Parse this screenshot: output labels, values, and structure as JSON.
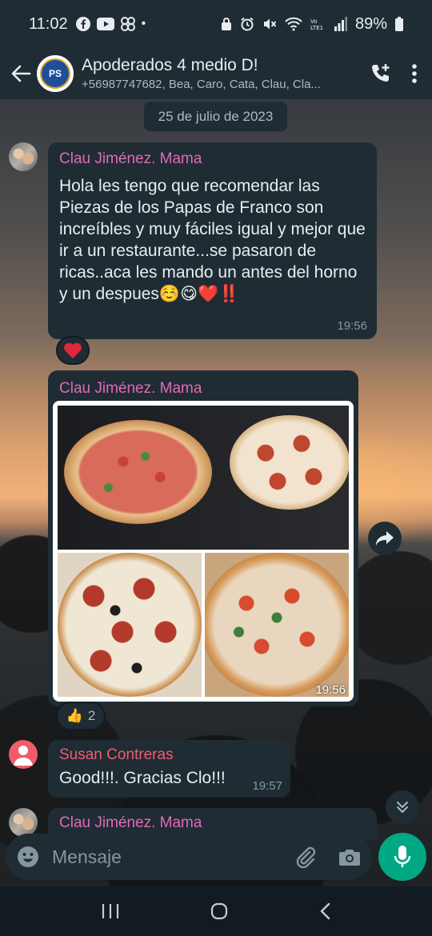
{
  "status_bar": {
    "time": "11:02",
    "dot": "•",
    "battery": "89%",
    "left_icons": [
      "facebook-icon",
      "youtube-icon",
      "pinwheel-icon"
    ],
    "right_icons": [
      "lock-icon",
      "alarm-icon",
      "mute-icon",
      "wifi-icon",
      "lte-icon",
      "signal-icon",
      "battery-icon"
    ]
  },
  "header": {
    "title": "Apoderados 4 medio D!",
    "subtitle": "+56987747682, Bea, Caro, Cata, Clau, Cla...",
    "avatar_text": "PS",
    "accent": "#1f2c34"
  },
  "date_chip": "25 de julio de 2023",
  "messages": [
    {
      "sender": "Clau Jiménez. Mama",
      "text": "Hola les tengo que recomendar las Piezas de los Papas de Franco son increíbles y muy fáciles igual y mejor que ir a un restaurante...se pasaron de ricas..aca les mando un antes del horno y un despues☺️😋❤️‼️",
      "time": "19:56",
      "reaction": "❤️"
    },
    {
      "sender": "Clau Jiménez. Mama",
      "type": "photo-album",
      "time": "19:56",
      "reaction": "👍",
      "reaction_count": "2"
    },
    {
      "sender": "Susan Contreras",
      "text": "Good!!!. Gracias Clo!!!",
      "time": "19:57"
    },
    {
      "sender": "Clau Jiménez. Mama"
    }
  ],
  "input": {
    "placeholder": "Mensaje"
  },
  "colors": {
    "bubble": "#1f2c34",
    "sender_pink": "#e26ab6",
    "sender_red": "#f15c6d",
    "mic_green": "#00a884",
    "time_gray": "#8696a0"
  }
}
